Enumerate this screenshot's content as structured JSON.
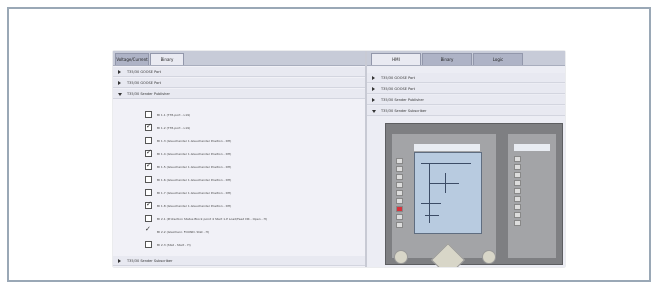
{
  "left_pane": {
    "tabs": [
      {
        "label": "Voltage/Current"
      },
      {
        "label": "Binary"
      }
    ],
    "rows": [
      {
        "label": "T35/30 GOOSE Port"
      },
      {
        "label": "T35/30 GOOSE Port"
      },
      {
        "label": "T35/30 Sender Publisher"
      },
      {
        "label": "T35/30 Sender Subscriber"
      }
    ],
    "checklist": [
      {
        "label": "BI 1.1 (T35.port - L19)",
        "checked": false
      },
      {
        "label": "BI 1.2 (T35.port - L19)",
        "checked": true
      },
      {
        "label": "BI 1.3 (Gleuchander 1.Gleuchander Position - DH)",
        "checked": false
      },
      {
        "label": "BI 1.4 (Gleuchander 1.Gleuchander Position - DH)",
        "checked": true
      },
      {
        "label": "BI 1.5 (Gleuchander 1.Gleuchander Position - DH)",
        "checked": true
      },
      {
        "label": "BI 1.6 (Gleuchander 1.Gleuchander Position - DH)",
        "checked": false
      },
      {
        "label": "BI 1.7 (Gleuchander 1.Gleuchander Position - DH)",
        "checked": false
      },
      {
        "label": "BI 1.8 (Gleuchander 1.Gleuchander Position - DH)",
        "checked": true
      },
      {
        "label": "BI 2.1 (Protection Status Block point 4 Start 1.P Load/Feed DR - Open - H)",
        "checked": false
      },
      {
        "label": "BI 2.2 (Gleichenr. FOUND. Stat - H)",
        "checked": true
      },
      {
        "label": "BI 2.3 (Stat - Start - H)",
        "checked": false
      }
    ]
  },
  "right_pane": {
    "tabs": [
      {
        "label": "HMI"
      },
      {
        "label": "Binary"
      },
      {
        "label": "Logic"
      }
    ],
    "rows": [
      {
        "label": "T35/30 GOOSE Port"
      },
      {
        "label": "T35/30 GOOSE Port"
      },
      {
        "label": "T35/30 Sender Publisher"
      },
      {
        "label": "T35/30 Sender Subscriber"
      }
    ]
  }
}
